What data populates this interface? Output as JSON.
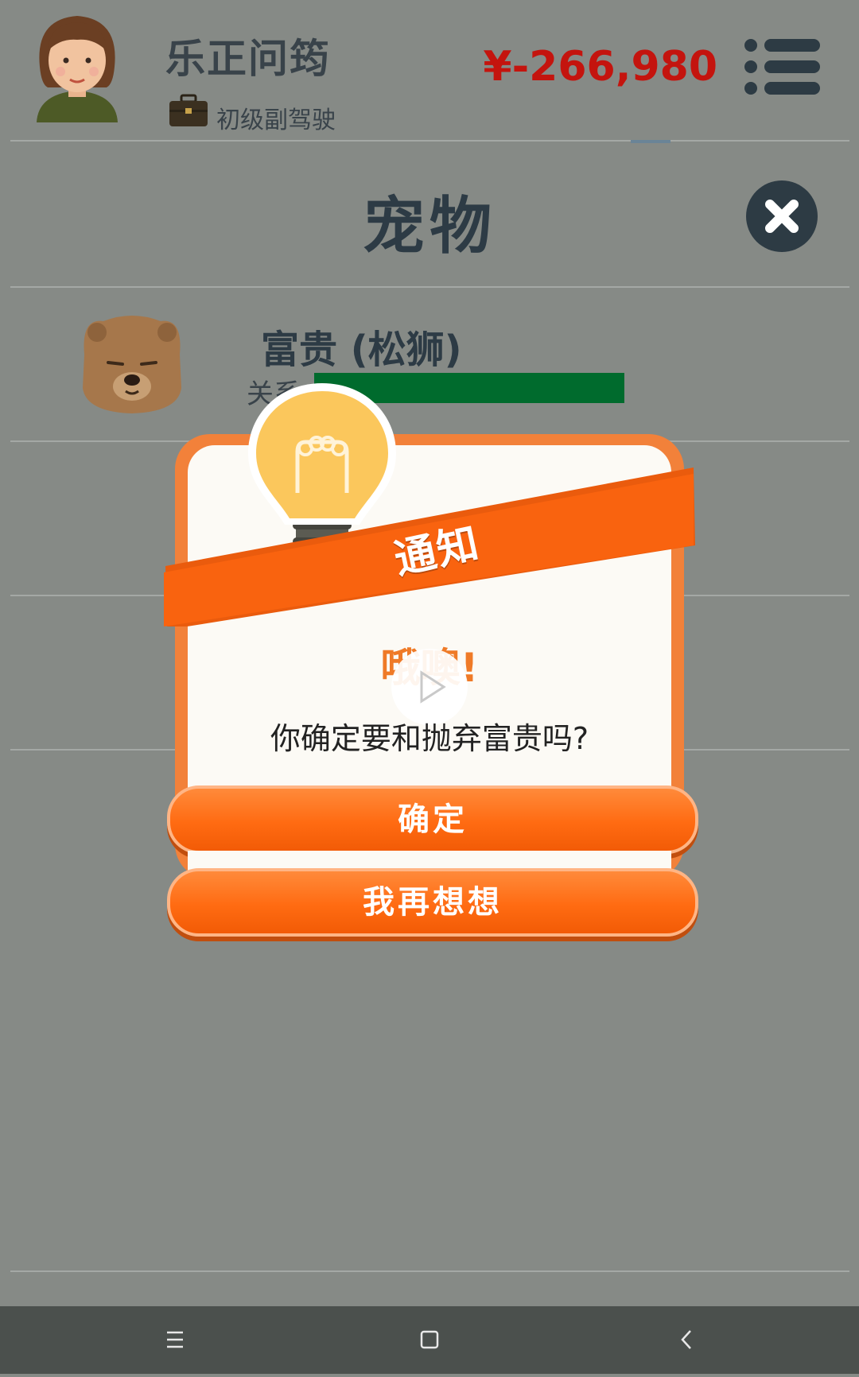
{
  "header": {
    "player_name": "乐正问筠",
    "job_title": "初级副驾驶",
    "money": "¥-266,980"
  },
  "page": {
    "title": "宠物"
  },
  "pet": {
    "name": "富贵 (松狮)",
    "relationship_label": "关系",
    "relationship_level": 1.0
  },
  "dialog": {
    "banner": "通知",
    "heading": "哦噢!",
    "message": "你确定要和抛弃富贵吗?",
    "confirm_label": "确定",
    "cancel_label": "我再想想"
  },
  "colors": {
    "background": "#868a86",
    "money": "#c4140e",
    "accent": "#f26411",
    "relationship_bar": "#006b2d"
  },
  "icons": [
    "avatar-icon",
    "briefcase-icon",
    "menu-icon",
    "close-icon",
    "dog-icon",
    "lightbulb-icon",
    "play-icon",
    "nav-menu-icon",
    "nav-home-icon",
    "nav-back-icon"
  ]
}
